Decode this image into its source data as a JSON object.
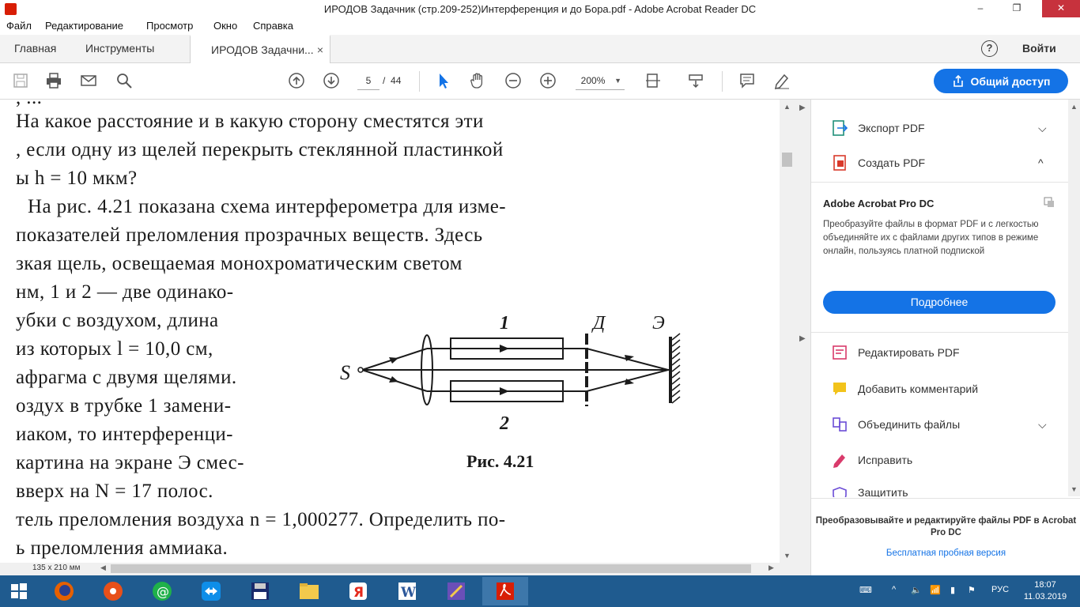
{
  "window": {
    "title": "ИРОДОВ Задачник (стр.209-252)Интерференция и до Бора.pdf - Adobe Acrobat Reader DC",
    "minimize": "–",
    "maximize": "❐",
    "close": "✕"
  },
  "menu": [
    "Файл",
    "Редактирование",
    "Просмотр",
    "Окно",
    "Справка"
  ],
  "tabs": {
    "home": "Главная",
    "tools": "Инструменты",
    "document": "ИРОДОВ Задачни...",
    "close": "×"
  },
  "header": {
    "help": "?",
    "login": "Войти"
  },
  "toolbar": {
    "page_current": "5",
    "page_separator": "/",
    "page_total": "44",
    "zoom": "200%",
    "share_label": "Общий доступ"
  },
  "document": {
    "lines": [
      ", ...",
      "На какое расстояние и в какую сторону сместятся эти",
      ", если одну из щелей перекрыть стеклянной пластинкой",
      "ы  h = 10 мкм?",
      "На рис. 4.21 показана схема интерферометра для изме-",
      "показателей преломления прозрачных веществ. Здесь",
      "зкая   щель,   освещаемая   монохроматическим   светом",
      "нм, 1 и 2 — две одинако-",
      "убки  с  воздухом,  длина",
      "  из  которых  l = 10,0  см,",
      "афрагма с двумя щелями.",
      "оздух в трубке 1 замени-",
      "иаком, то интерференци-",
      "картина на экране Э смес-",
      "  вверх   на   N = 17 полос.",
      "тель преломления воздуха n = 1,000277. Определить по-",
      "ь преломления аммиака."
    ],
    "figure": {
      "label_1": "1",
      "label_2": "2",
      "label_d": "Д",
      "label_e": "Э",
      "label_s": "S",
      "caption": "Рис. 4.21"
    },
    "page_size": "135 x 210 мм"
  },
  "panel": {
    "export": "Экспорт PDF",
    "create": "Создать PDF",
    "promo_title": "Adobe Acrobat Pro DC",
    "promo_text": "Преобразуйте файлы в формат PDF и с легкостью объединяйте их с файлами других типов в режиме онлайн, пользуясь платной подпиской",
    "promo_button": "Подробнее",
    "edit": "Редактировать PDF",
    "comment": "Добавить комментарий",
    "combine": "Объединить файлы",
    "fix": "Исправить",
    "protect": "Защитить",
    "bottom_promo": "Преобразовывайте и редактируйте файлы PDF в Acrobat Pro DC",
    "trial_link": "Бесплатная пробная версия"
  },
  "taskbar": {
    "lang": "РУС",
    "time": "18:07",
    "date": "11.03.2019"
  },
  "colors": {
    "accent": "#1473e6",
    "taskbar": "#1f5b8f",
    "close": "#c7323d"
  }
}
